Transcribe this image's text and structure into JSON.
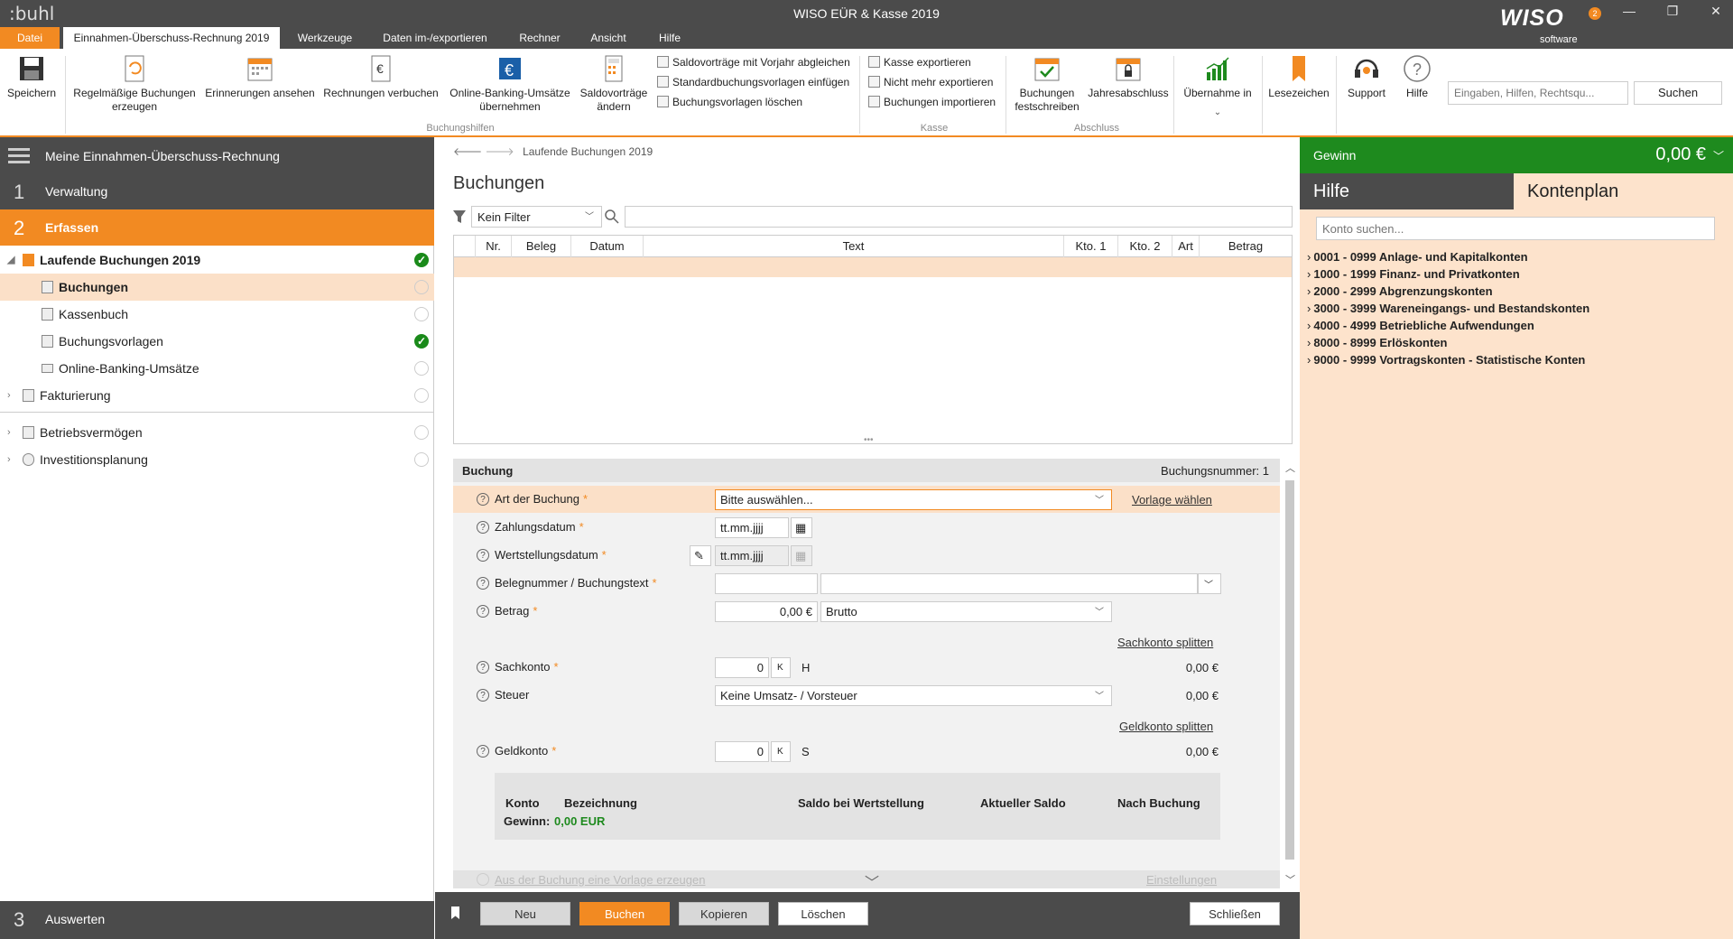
{
  "titlebar": {
    "brand": ":buhl",
    "title": "WISO EÜR & Kasse 2019",
    "logo": "WISO",
    "logo_sub": "software",
    "badge": "2"
  },
  "menu_tabs": [
    "Datei",
    "Einnahmen-Überschuss-Rechnung 2019",
    "Werkzeuge",
    "Daten im-/exportieren",
    "Rechner",
    "Ansicht",
    "Hilfe"
  ],
  "ribbon": {
    "save": "Speichern",
    "recurring": [
      "Regelmäßige Buchungen",
      "erzeugen"
    ],
    "reminders": "Erinnerungen ansehen",
    "invoices": "Rechnungen verbuchen",
    "online_banking": [
      "Online-Banking-Umsätze",
      "übernehmen"
    ],
    "balances": [
      "Saldovorträge",
      "ändern"
    ],
    "small": [
      "Saldovorträge mit Vorjahr abgleichen",
      "Standardbuchungsvorlagen einfügen",
      "Buchungsvorlagen löschen"
    ],
    "kasse_small": [
      "Kasse exportieren",
      "Nicht mehr exportieren",
      "Buchungen importieren"
    ],
    "fix": [
      "Buchungen",
      "festschreiben"
    ],
    "annual": "Jahresabschluss",
    "takeover": "Übernahme in",
    "bookmarks": "Lesezeichen",
    "support": "Support",
    "help": "Hilfe",
    "groups": [
      "Buchungshilfen",
      "Kasse",
      "Abschluss"
    ],
    "search_placeholder": "Eingaben, Hilfen, Rechtsqu...",
    "search_button": "Suchen"
  },
  "sidebar": {
    "top": "Meine Einnahmen-Überschuss-Rechnung",
    "step1": {
      "num": "1",
      "label": "Verwaltung"
    },
    "step2": {
      "num": "2",
      "label": "Erfassen"
    },
    "step3": {
      "num": "3",
      "label": "Auswerten"
    },
    "items": [
      "Laufende Buchungen 2019",
      "Buchungen",
      "Kassenbuch",
      "Buchungsvorlagen",
      "Online-Banking-Umsätze",
      "Fakturierung",
      "Betriebsvermögen",
      "Investitionsplanung"
    ]
  },
  "main": {
    "breadcrumb": "Laufende Buchungen 2019",
    "title": "Buchungen",
    "filter": "Kein Filter",
    "columns": [
      "Nr.",
      "Beleg",
      "Datum",
      "Text",
      "Kto. 1",
      "Kto. 2",
      "Art",
      "Betrag"
    ]
  },
  "form": {
    "title": "Buchung",
    "number": "Buchungsnummer: 1",
    "art_label": "Art der Buchung",
    "art_value": "Bitte auswählen...",
    "template_link": "Vorlage wählen",
    "zahlung_label": "Zahlungsdatum",
    "date_placeholder": "tt.mm.jjjj",
    "wert_label": "Wertstellungsdatum",
    "beleg_label": "Belegnummer / Buchungstext",
    "betrag_label": "Betrag",
    "betrag_value": "0,00 €",
    "brutto": "Brutto",
    "split_sach": "Sachkonto splitten",
    "sach_label": "Sachkonto",
    "zero": "0",
    "k": "K",
    "h": "H",
    "s": "S",
    "amount": "0,00 €",
    "steuer_label": "Steuer",
    "steuer_value": "Keine Umsatz- / Vorsteuer",
    "split_geld": "Geldkonto splitten",
    "geld_label": "Geldkonto",
    "saldo_konto": "Konto",
    "saldo_bez": "Bezeichnung",
    "saldo_wert": "Saldo bei Wertstellung",
    "saldo_akt": "Aktueller Saldo",
    "saldo_nach": "Nach Buchung",
    "gewinn_label": "Gewinn:",
    "gewinn_value": "0,00 EUR",
    "vorlage_erz": "Aus der Buchung eine Vorlage erzeugen",
    "einstellungen": "Einstellungen",
    "req": "*",
    "qm": "?"
  },
  "buttons": {
    "neu": "Neu",
    "buchen": "Buchen",
    "kopieren": "Kopieren",
    "loeschen": "Löschen",
    "schliessen": "Schließen"
  },
  "right": {
    "gain_label": "Gewinn",
    "gain_value": "0,00 €",
    "tab_help": "Hilfe",
    "tab_accounts": "Kontenplan",
    "search_placeholder": "Konto suchen...",
    "accounts": [
      "0001 - 0999 Anlage- und Kapitalkonten",
      "1000 - 1999 Finanz- und Privatkonten",
      "2000 - 2999 Abgrenzungskonten",
      "3000 - 3999 Wareneingangs- und Bestandskonten",
      "4000 - 4999 Betriebliche Aufwendungen",
      "8000 - 8999 Erlöskonten",
      "9000 - 9999 Vortragskonten - Statistische Konten"
    ]
  },
  "colors": {
    "accent": "#f28a22",
    "dark": "#4b4b4b",
    "green": "#1e8a1e",
    "highlight": "#fbe0c8"
  }
}
